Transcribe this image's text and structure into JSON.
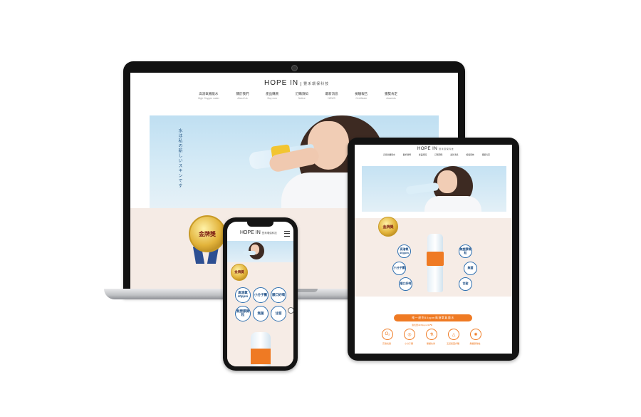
{
  "desktop": {
    "logo": "HOPE IN",
    "logo_sub": "豐禾環保科技",
    "nav": [
      {
        "zh": "高溶氧機能水",
        "en": "High Oxygen water"
      },
      {
        "zh": "關於我們",
        "en": "About Us"
      },
      {
        "zh": "產品購買",
        "en": "Buy now"
      },
      {
        "zh": "訂購須知",
        "en": "Notice"
      },
      {
        "zh": "最新消息",
        "en": "NEWS"
      },
      {
        "zh": "檢驗報告",
        "en": "Certificate"
      },
      {
        "zh": "獲獎肯定",
        "en": "Awareds"
      }
    ],
    "hero_text": "水は私の新しいスキンです",
    "award": "金牌獎"
  },
  "tablet": {
    "logo": "HOPE IN",
    "logo_sub": "豐禾環保科技",
    "nav": [
      "高溶氧機能水",
      "關於我們",
      "產品購買",
      "訂購須知",
      "最新消息",
      "檢驗報告",
      "獲獎肯定"
    ],
    "award": "金牌獎",
    "bubbles": [
      "高溶氧40ppm",
      "小分子團",
      "順口好喝",
      "無菌",
      "甘甜",
      "無塑膠微粒"
    ],
    "banner": "唯一達到40ppm高溶氧氣量水",
    "banner_sub": "溶氧量40±5ppm/40℃",
    "features": [
      {
        "icon": "O₂",
        "label": "高溶氧量"
      },
      {
        "icon": "◎",
        "label": "小分子團"
      },
      {
        "icon": "⚗",
        "label": "無塑化劑"
      },
      {
        "icon": "△",
        "label": "五道殺菌步驟"
      },
      {
        "icon": "✺",
        "label": "無塑膠微粒"
      }
    ]
  },
  "phone": {
    "logo": "HOPE IN",
    "logo_sub": "豐禾環保科技",
    "award": "金牌獎",
    "bubbles": [
      "高溶氧40ppm",
      "小分子團",
      "順口好喝",
      "無塑膠微粒",
      "無菌",
      "甘甜"
    ]
  },
  "colors": {
    "accent": "#ef7a23",
    "bubble_border": "#2d6fb0",
    "band_bg": "#f5ebe5",
    "sky": "#bfdff2"
  }
}
